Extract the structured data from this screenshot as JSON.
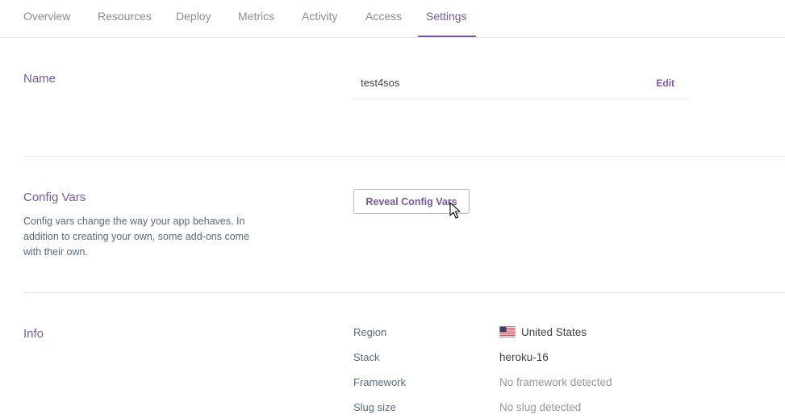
{
  "tabs": [
    {
      "label": "Overview"
    },
    {
      "label": "Resources"
    },
    {
      "label": "Deploy"
    },
    {
      "label": "Metrics"
    },
    {
      "label": "Activity"
    },
    {
      "label": "Access"
    },
    {
      "label": "Settings",
      "active": true
    }
  ],
  "name_section": {
    "title": "Name",
    "value": "test4sos",
    "edit_label": "Edit"
  },
  "config_vars": {
    "title": "Config Vars",
    "description": "Config vars change the way your app behaves. In addition to creating your own, some add-ons come with their own.",
    "button_label": "Reveal Config Vars"
  },
  "info": {
    "title": "Info",
    "rows": [
      {
        "label": "Region",
        "value": "United States",
        "icon": "us-flag-icon"
      },
      {
        "label": "Stack",
        "value": "heroku-16"
      },
      {
        "label": "Framework",
        "value": "No framework detected"
      },
      {
        "label": "Slug size",
        "value": "No slug detected"
      }
    ]
  },
  "colors": {
    "accent": "#79589f",
    "muted_text": "#96969f",
    "divider": "#e7e7ec"
  }
}
